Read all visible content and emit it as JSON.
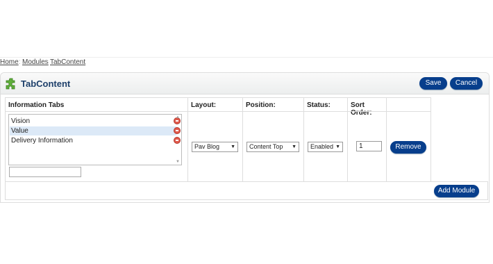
{
  "breadcrumb": {
    "home": "Home",
    "sep": "::",
    "modules": "Modules",
    "current": "TabContent"
  },
  "header": {
    "title": "TabContent",
    "save": "Save",
    "cancel": "Cancel"
  },
  "columns": {
    "tabs": "Information Tabs",
    "layout": "Layout:",
    "position": "Position:",
    "status": "Status:",
    "sort": "Sort Order:"
  },
  "tabs_list": [
    {
      "label": "Vision",
      "selected": false
    },
    {
      "label": "Value",
      "selected": true
    },
    {
      "label": "Delivery Information",
      "selected": false
    }
  ],
  "new_tab_input": {
    "value": ""
  },
  "row": {
    "layout": "Pav Blog",
    "position": "Content Top",
    "status": "Enabled",
    "sort_order": "1",
    "remove": "Remove"
  },
  "footer": {
    "add_module": "Add Module"
  },
  "colors": {
    "accent": "#073e8c",
    "title": "#1d3f6a",
    "selection": "#dce9f7",
    "remove_icon": "#e05a4c"
  },
  "icons": {
    "header": "puzzle-icon",
    "remove": "remove-circle-icon",
    "dropdown": "chevron-down-icon"
  }
}
